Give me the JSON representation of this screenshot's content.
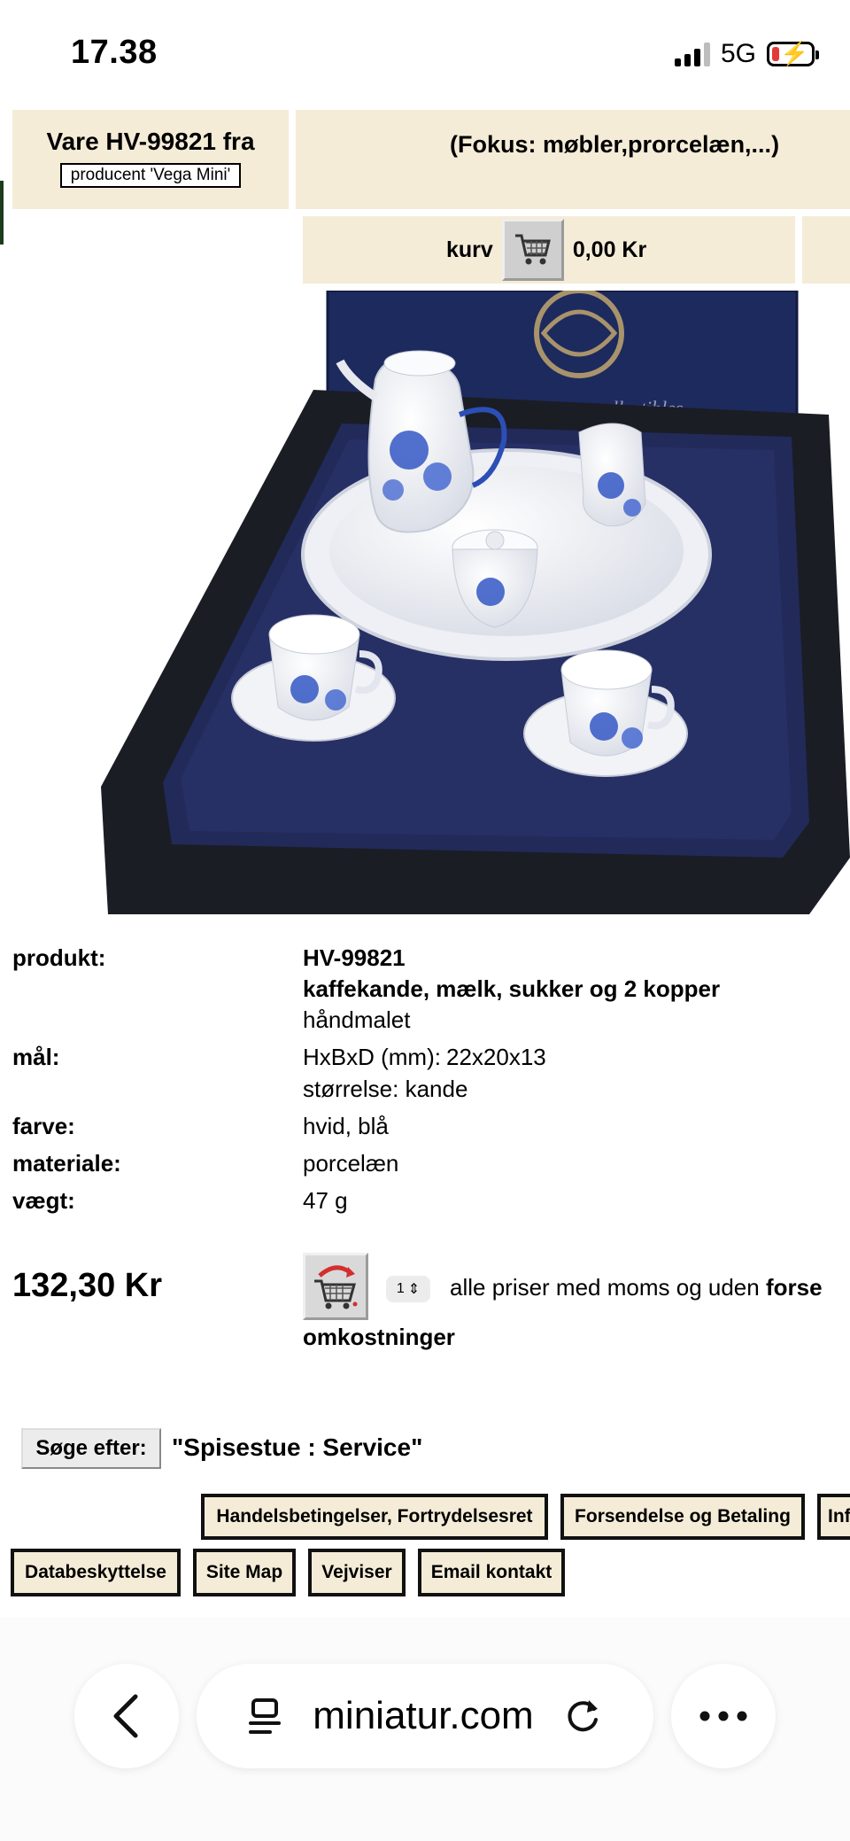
{
  "status_bar": {
    "time": "17.38",
    "network": "5G"
  },
  "header": {
    "item_title": "Vare HV-99821 fra",
    "item_producer": "producent 'Vega Mini'",
    "focus": "(Fokus: møbler,prorcelæn,...)"
  },
  "cart": {
    "label": "kurv",
    "total": "0,00 Kr"
  },
  "product": {
    "labels": {
      "product": "produkt:",
      "dims": "mål:",
      "color": "farve:",
      "material": "materiale:",
      "weight": "vægt:"
    },
    "code": "HV-99821",
    "name": "kaffekande, mælk, sukker og 2 kopper",
    "note": "håndmalet",
    "dims_label": "HxBxD (mm):",
    "dims_value": "22x20x13",
    "size": "størrelse: kande",
    "color": "hvid, blå",
    "material": "porcelæn",
    "weight": "47 g",
    "image_text": "iature collectibles"
  },
  "purchase": {
    "price": "132,30 Kr",
    "quantity": "1",
    "note_prefix": "alle priser med moms og uden ",
    "note_bold": "forse",
    "note_line2": "omkostninger"
  },
  "search": {
    "button": "Søge efter:",
    "query": "\"Spisestue : Service\""
  },
  "footer_nav": {
    "row1": [
      "Handelsbetingelser, Fortrydelsesret",
      "Forsendelse og Betaling",
      "Inf"
    ],
    "row2": [
      "Databeskyttelse",
      "Site Map",
      "Vejviser",
      "Email kontakt"
    ]
  },
  "browser": {
    "url": "miniatur.com"
  }
}
